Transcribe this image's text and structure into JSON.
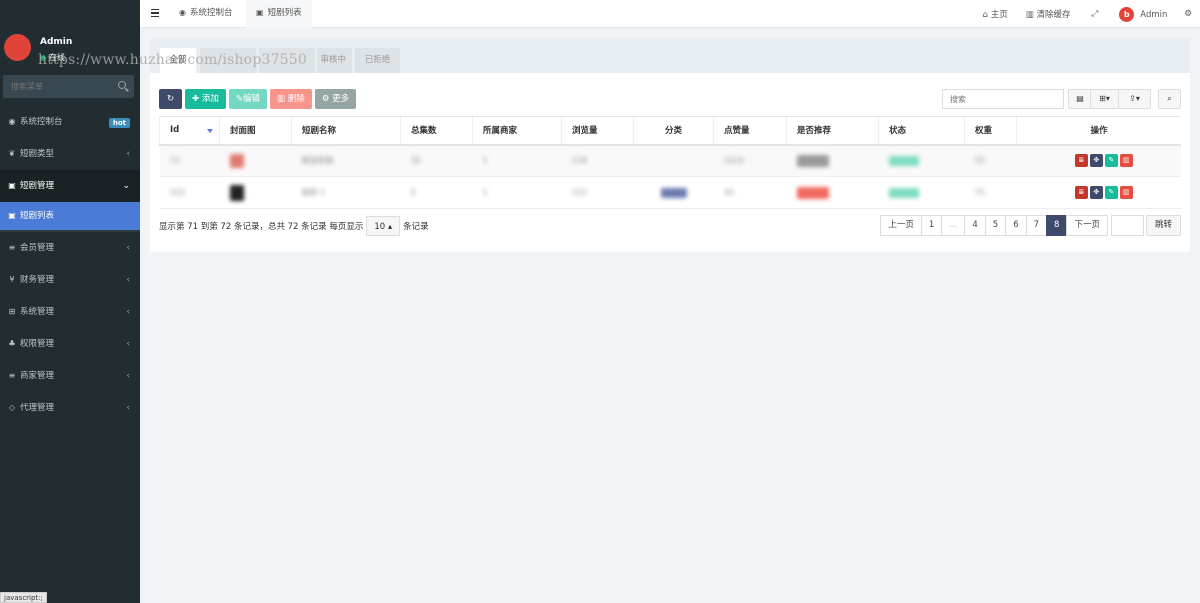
{
  "sidebar": {
    "user": {
      "name": "Admin",
      "status": "在线"
    },
    "watermark": "https://www.huzhan.com/ishop37550",
    "search_placeholder": "搜索菜单",
    "items": [
      {
        "icon": "dashboard-icon",
        "glyph": "◉",
        "label": "系统控制台",
        "badge": "hot"
      },
      {
        "icon": "leaf-icon",
        "glyph": "❦",
        "label": "短剧类型",
        "arrow": "‹"
      },
      {
        "icon": "file-icon",
        "glyph": "▣",
        "label": "短剧管理",
        "arrow": "⌄"
      },
      {
        "icon": "file-icon",
        "glyph": "▣",
        "label": "短剧列表"
      },
      {
        "icon": "list-icon",
        "glyph": "≡",
        "label": "会员管理",
        "arrow": "‹"
      },
      {
        "icon": "yen-icon",
        "glyph": "¥",
        "label": "财务管理",
        "arrow": "‹"
      },
      {
        "icon": "windows-icon",
        "glyph": "⊞",
        "label": "系统管理",
        "arrow": "‹"
      },
      {
        "icon": "users-icon",
        "glyph": "♣",
        "label": "权限管理",
        "arrow": "‹"
      },
      {
        "icon": "list-icon",
        "glyph": "≡",
        "label": "商家管理",
        "arrow": "‹"
      },
      {
        "icon": "diamond-icon",
        "glyph": "◇",
        "label": "代理管理",
        "arrow": "‹"
      }
    ]
  },
  "status_bar": "javascript:;",
  "topbar": {
    "tabs": [
      {
        "glyph": "◉",
        "label": "系统控制台"
      },
      {
        "glyph": "▣",
        "label": "短剧列表"
      }
    ],
    "right": {
      "home": "主页",
      "clear_cache": "清除缓存",
      "admin": "Admin"
    }
  },
  "filter_tabs": [
    "全部",
    "",
    "",
    "审核中",
    "已拒绝"
  ],
  "toolbar": {
    "add": "添加",
    "edit": "编辑",
    "delete": "删除",
    "more": "更多",
    "search_placeholder": "搜索"
  },
  "table": {
    "headers": [
      "Id",
      "封面图",
      "短剧名称",
      "总集数",
      "所属商家",
      "浏览量",
      "分类",
      "点赞量",
      "是否推荐",
      "状态",
      "权重",
      "操作"
    ],
    "rows": [
      {
        "id": "72",
        "name": "替身新娘",
        "episodes": "30",
        "merchant": "1",
        "views": "128",
        "likes": "1024",
        "weight": "55"
      },
      {
        "id": "103",
        "name": "旋即-1",
        "episodes": "0",
        "merchant": "1",
        "views": "153",
        "likes": "30",
        "weight": "75"
      }
    ]
  },
  "pagination": {
    "info_prefix": "显示第 71 到第 72 条记录，总共 72 条记录 每页显示",
    "page_size": "10 ▴",
    "info_suffix": "条记录",
    "prev": "上一页",
    "pages": [
      "1",
      "...",
      "4",
      "5",
      "6",
      "7",
      "8"
    ],
    "current": "8",
    "next": "下一页",
    "jump": "跳转"
  },
  "colors": {
    "sidebar_bg": "#222d32",
    "active_menu": "#4a7bd6",
    "primary_dark": "#3f4a6a",
    "success": "#18bc9c",
    "danger": "#e74c3c"
  }
}
